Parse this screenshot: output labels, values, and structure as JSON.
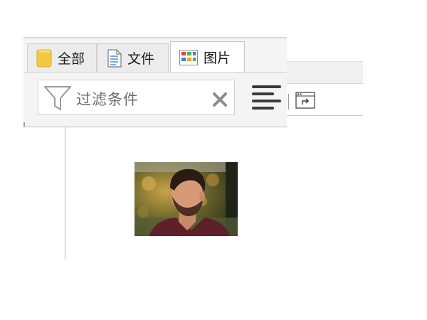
{
  "tabs": [
    {
      "label": "全部",
      "icon": "folder-icon"
    },
    {
      "label": "文件",
      "icon": "document-icon"
    },
    {
      "label": "图片",
      "icon": "image-grid-icon",
      "active": true
    }
  ],
  "filter": {
    "placeholder": "过滤条件",
    "clear_icon": "clear-icon",
    "filter_icon": "funnel-icon"
  },
  "toolbar": {
    "align_icon": "align-left-icon",
    "window_icon": "open-window-icon"
  },
  "content": {
    "thumbnail_icon": "photo-thumbnail"
  }
}
